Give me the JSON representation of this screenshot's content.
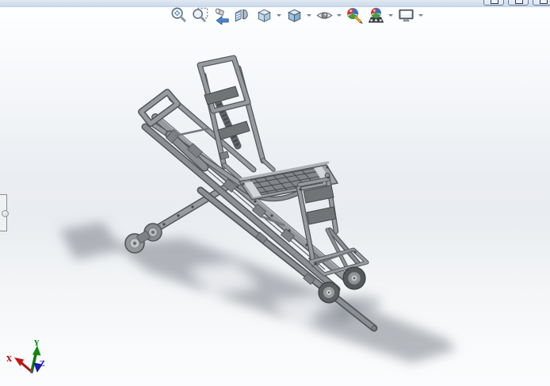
{
  "window_controls": {
    "buttons": [
      {
        "name": "minimize-window",
        "tooltip": "Minimize"
      },
      {
        "name": "restore-window",
        "tooltip": "Restore Down"
      },
      {
        "name": "close-window",
        "tooltip": "Close"
      }
    ]
  },
  "toolbar": {
    "name": "View (Heads-Up)",
    "items": [
      {
        "name": "zoom-to-fit",
        "tooltip": "Zoom to Fit",
        "has_dropdown": false
      },
      {
        "name": "zoom-to-area",
        "tooltip": "Zoom to Area",
        "has_dropdown": false
      },
      {
        "name": "previous-view",
        "tooltip": "Previous View",
        "has_dropdown": false
      },
      {
        "name": "section-view",
        "tooltip": "Section View",
        "has_dropdown": false
      },
      {
        "name": "view-orientation",
        "tooltip": "View Orientation",
        "has_dropdown": true
      },
      {
        "name": "display-style",
        "tooltip": "Display Style",
        "has_dropdown": true
      },
      {
        "name": "hide-show-items",
        "tooltip": "Hide/Show Items",
        "has_dropdown": true
      },
      {
        "name": "edit-appearance",
        "tooltip": "Edit Appearance",
        "has_dropdown": false
      },
      {
        "name": "apply-scene",
        "tooltip": "Apply Scene",
        "has_dropdown": true
      },
      {
        "name": "view-settings",
        "tooltip": "View Settings",
        "has_dropdown": true
      }
    ]
  },
  "viewport": {
    "content": "3D shaded model of a stair-climbing trolley chair assembly with four wheels, viewed in isometric orientation with soft ground shadow"
  },
  "left_panel_tab": {
    "tooltip": "FeatureManager design tree (collapsed)"
  },
  "triad": {
    "x_label": "X",
    "y_label": "Y",
    "z_label": "Z",
    "x_color": "#c00000",
    "y_color": "#0a8a0a",
    "z_color": "#2020c0"
  },
  "colors": {
    "top_strip": "#d3deee",
    "background_mid": "#e9edf1",
    "model_gray": "#9399",
    "model_tube": "#979ba0",
    "model_outline": "#53575a",
    "dark_plate": "#717477",
    "shadow": "#70767f"
  }
}
